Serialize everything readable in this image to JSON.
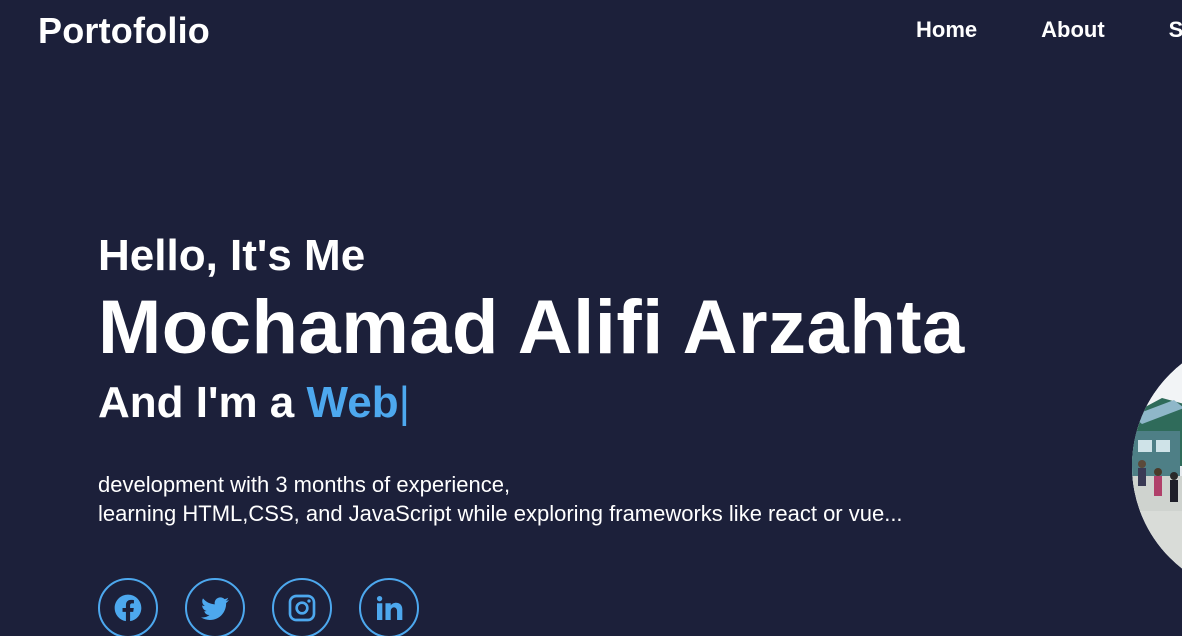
{
  "header": {
    "logo": "Portofolio",
    "nav": [
      "Home",
      "About",
      "S"
    ]
  },
  "hero": {
    "greeting": "Hello, It's Me",
    "name": "Mochamad Alifi Arzahta",
    "role_prefix": "And I'm a ",
    "role_typed": "Web",
    "cursor": "|",
    "description_line1": "development with 3 months of experience,",
    "description_line2": "learning HTML,CSS, and JavaScript while exploring frameworks like react or vue..."
  },
  "social_icons": [
    "facebook-icon",
    "twitter-icon",
    "instagram-icon",
    "linkedin-icon"
  ],
  "colors": {
    "background": "#1c203a",
    "accent": "#4da8ee",
    "text": "#ffffff"
  }
}
